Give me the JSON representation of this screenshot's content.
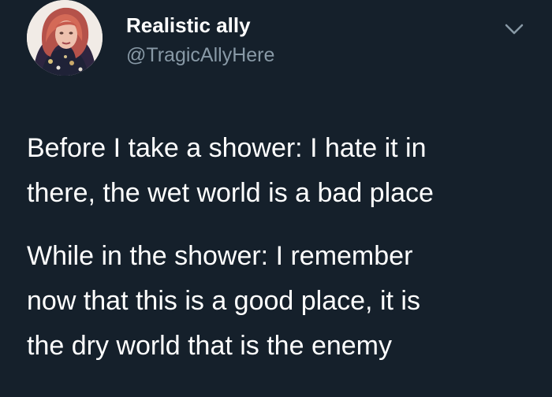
{
  "tweet": {
    "display_name": "Realistic ally",
    "handle": "@TragicAllyHere",
    "paragraphs": [
      {
        "line1": "Before I take a shower: I hate it in",
        "line2": "there, the wet world is a bad place"
      },
      {
        "line1": "While in the shower: I remember",
        "line2": "now that this is a good place, it is",
        "line3": "the dry world that is the enemy"
      }
    ],
    "menu_icon": "chevron-down-icon",
    "avatar_icon": "profile-photo"
  },
  "colors": {
    "background": "#15202b",
    "text_primary": "#ffffff",
    "text_secondary": "#8899a6"
  }
}
